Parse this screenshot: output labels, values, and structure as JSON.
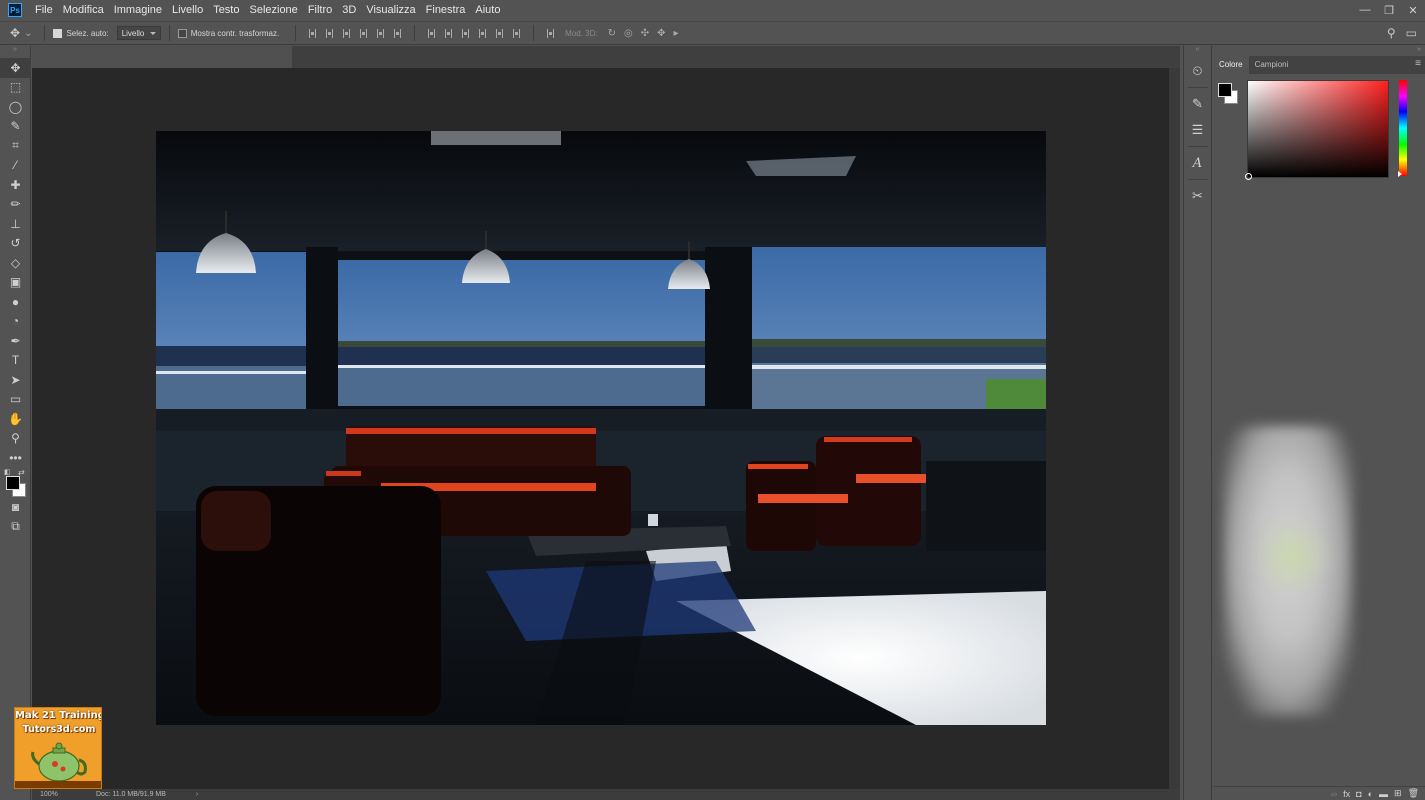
{
  "app": {
    "logo_text": "Ps",
    "menu": [
      "File",
      "Modifica",
      "Immagine",
      "Livello",
      "Testo",
      "Selezione",
      "Filtro",
      "3D",
      "Visualizza",
      "Finestra",
      "Aiuto"
    ],
    "window_controls": [
      "—",
      "❐",
      "✕"
    ]
  },
  "options_bar": {
    "auto_select_label": "Selez. auto:",
    "auto_select_checked": true,
    "auto_select_target": "Livello",
    "show_transform_label": "Mostra contr. trasformaz.",
    "show_transform_checked": false,
    "mode_3d_label": "Mod. 3D:"
  },
  "toolbar": {
    "tools": [
      {
        "name": "move-tool",
        "glyph": "✥",
        "active": true
      },
      {
        "name": "marquee-tool",
        "glyph": "⬚",
        "active": false
      },
      {
        "name": "lasso-tool",
        "glyph": "◯",
        "active": false
      },
      {
        "name": "quick-selection-tool",
        "glyph": "✎",
        "active": false
      },
      {
        "name": "crop-tool",
        "glyph": "⌗",
        "active": false
      },
      {
        "name": "eyedropper-tool",
        "glyph": "⁄",
        "active": false
      },
      {
        "name": "healing-brush-tool",
        "glyph": "✚",
        "active": false
      },
      {
        "name": "brush-tool",
        "glyph": "✏",
        "active": false
      },
      {
        "name": "clone-stamp-tool",
        "glyph": "⊥",
        "active": false
      },
      {
        "name": "history-brush-tool",
        "glyph": "↺",
        "active": false
      },
      {
        "name": "eraser-tool",
        "glyph": "◇",
        "active": false
      },
      {
        "name": "gradient-tool",
        "glyph": "▣",
        "active": false
      },
      {
        "name": "blur-tool",
        "glyph": "●",
        "active": false
      },
      {
        "name": "dodge-tool",
        "glyph": "◔",
        "active": false
      },
      {
        "name": "pen-tool",
        "glyph": "✒",
        "active": false
      },
      {
        "name": "type-tool",
        "glyph": "T",
        "active": false
      },
      {
        "name": "path-selection-tool",
        "glyph": "➤",
        "active": false
      },
      {
        "name": "rectangle-tool",
        "glyph": "▭",
        "active": false
      },
      {
        "name": "hand-tool",
        "glyph": "✋",
        "active": false
      },
      {
        "name": "zoom-tool",
        "glyph": "⚲",
        "active": false
      },
      {
        "name": "more-tools",
        "glyph": "•••",
        "active": false
      }
    ],
    "bottom_tools": [
      {
        "name": "quick-mask-tool",
        "glyph": "◙"
      },
      {
        "name": "screen-mode-tool",
        "glyph": "⧉"
      }
    ]
  },
  "status_bar": {
    "zoom": "100%",
    "doc_info": "Doc: 11.0 MB/91.9 MB",
    "arrow": "›"
  },
  "watermark": {
    "line1": "Mak 21 Training",
    "line2": "Tutors3d.com"
  },
  "panel_strip": {
    "icons": [
      "history-icon",
      "brush-settings-icon",
      "adjustments-icon",
      "character-icon",
      "tools-preset-icon"
    ]
  },
  "color_panel": {
    "tabs": [
      "Colore",
      "Campioni"
    ],
    "active_tab": "Colore",
    "foreground": "#000000",
    "background": "#ffffff",
    "hue_color": "#ff2020"
  },
  "colors": {
    "app_bg": "#535353",
    "workspace_bg": "#282828",
    "sofa_red": "#c0321a",
    "sky_blue": "#3f6fae"
  }
}
